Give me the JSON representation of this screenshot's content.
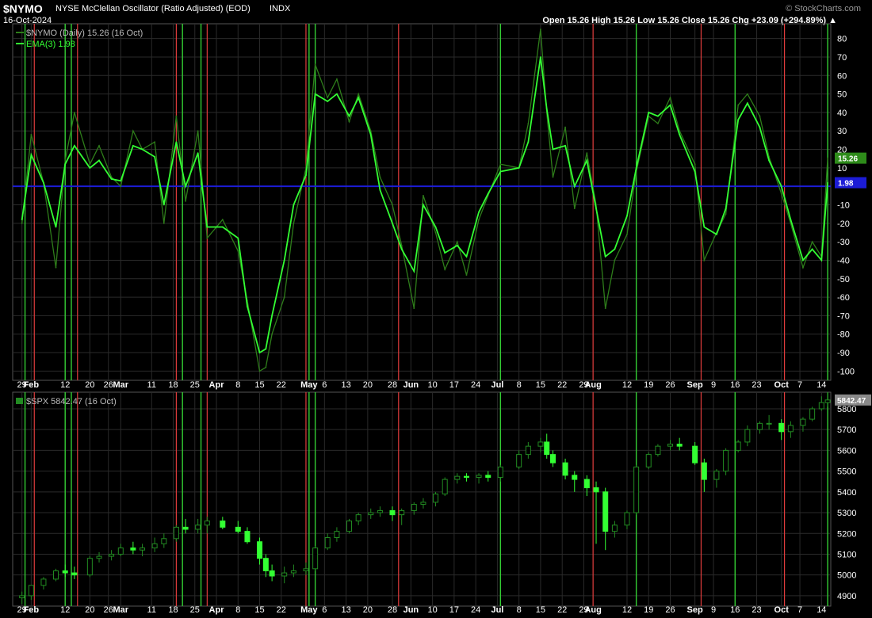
{
  "header": {
    "symbol": "$NYMO",
    "name": "NYSE McClellan Oscillator (Ratio Adjusted) (EOD)",
    "exchange": "INDX",
    "date": "16-Oct-2024",
    "watermark": "© StockCharts.com",
    "ohlc": "Open 15.26  High 15.26  Low 15.26  Close 15.26  Chg +23.09 (+294.89%) ▲"
  },
  "colors": {
    "background": "#000000",
    "osc_line": "#2e7d1a",
    "ema_line": "#33ff33",
    "zero_line": "#1c1cd6",
    "buy_signal": "#33cc33",
    "sell_signal": "#e03c3c",
    "candle_up": "#228b22",
    "candle_down": "#33ff33",
    "grid": "#2a2a2a"
  },
  "chart_data": [
    {
      "type": "line",
      "legend": [
        "$NYMO (Daily) 15.26 (16 Oct)",
        "EMA(3) 1.98"
      ],
      "ylim": [
        -105,
        88
      ],
      "yticks": [
        80,
        70,
        60,
        50,
        40,
        30,
        20,
        10,
        -10,
        -20,
        -30,
        -40,
        -50,
        -60,
        -70,
        -80,
        -90,
        -100
      ],
      "last_value_labels": [
        "15.26",
        "1.98"
      ],
      "zero_line": 0,
      "series": [
        {
          "name": "$NYMO (Daily)",
          "dates": [
            "2024-01-29",
            "2024-02-01",
            "2024-02-05",
            "2024-02-09",
            "2024-02-12",
            "2024-02-15",
            "2024-02-20",
            "2024-02-23",
            "2024-02-27",
            "2024-03-01",
            "2024-03-05",
            "2024-03-08",
            "2024-03-12",
            "2024-03-15",
            "2024-03-19",
            "2024-03-22",
            "2024-03-26",
            "2024-03-29",
            "2024-04-03",
            "2024-04-08",
            "2024-04-11",
            "2024-04-15",
            "2024-04-17",
            "2024-04-19",
            "2024-04-23",
            "2024-04-26",
            "2024-04-30",
            "2024-05-03",
            "2024-05-07",
            "2024-05-10",
            "2024-05-14",
            "2024-05-17",
            "2024-05-21",
            "2024-05-24",
            "2024-05-28",
            "2024-05-31",
            "2024-06-04",
            "2024-06-07",
            "2024-06-11",
            "2024-06-14",
            "2024-06-18",
            "2024-06-21",
            "2024-06-25",
            "2024-06-28",
            "2024-07-02",
            "2024-07-08",
            "2024-07-11",
            "2024-07-15",
            "2024-07-17",
            "2024-07-19",
            "2024-07-23",
            "2024-07-26",
            "2024-07-30",
            "2024-08-02",
            "2024-08-05",
            "2024-08-08",
            "2024-08-12",
            "2024-08-15",
            "2024-08-19",
            "2024-08-22",
            "2024-08-26",
            "2024-08-29",
            "2024-09-03",
            "2024-09-06",
            "2024-09-10",
            "2024-09-13",
            "2024-09-17",
            "2024-09-20",
            "2024-09-24",
            "2024-09-27",
            "2024-10-01",
            "2024-10-04",
            "2024-10-08",
            "2024-10-11",
            "2024-10-14",
            "2024-10-16"
          ],
          "values": [
            -20,
            28,
            2,
            -44,
            14,
            40,
            12,
            22,
            5,
            0,
            30,
            20,
            24,
            -20,
            38,
            -8,
            30,
            -28,
            -18,
            -35,
            -62,
            -100,
            -98,
            -80,
            -60,
            -20,
            10,
            66,
            48,
            58,
            35,
            50,
            30,
            5,
            -10,
            -32,
            -66,
            -5,
            -25,
            -45,
            -30,
            -48,
            -18,
            -5,
            12,
            10,
            34,
            85,
            40,
            5,
            32,
            -12,
            18,
            -10,
            -66,
            -40,
            -26,
            8,
            38,
            34,
            48,
            30,
            12,
            -40,
            -25,
            -15,
            44,
            50,
            38,
            16,
            -4,
            -20,
            -44,
            -30,
            -38,
            15.26
          ]
        },
        {
          "name": "EMA(3)",
          "dates": [
            "2024-01-29",
            "2024-02-01",
            "2024-02-05",
            "2024-02-09",
            "2024-02-12",
            "2024-02-15",
            "2024-02-20",
            "2024-02-23",
            "2024-02-27",
            "2024-03-01",
            "2024-03-05",
            "2024-03-08",
            "2024-03-12",
            "2024-03-15",
            "2024-03-19",
            "2024-03-22",
            "2024-03-26",
            "2024-03-29",
            "2024-04-03",
            "2024-04-08",
            "2024-04-11",
            "2024-04-15",
            "2024-04-17",
            "2024-04-19",
            "2024-04-23",
            "2024-04-26",
            "2024-04-30",
            "2024-05-03",
            "2024-05-07",
            "2024-05-10",
            "2024-05-14",
            "2024-05-17",
            "2024-05-21",
            "2024-05-24",
            "2024-05-28",
            "2024-05-31",
            "2024-06-04",
            "2024-06-07",
            "2024-06-11",
            "2024-06-14",
            "2024-06-18",
            "2024-06-21",
            "2024-06-25",
            "2024-06-28",
            "2024-07-02",
            "2024-07-08",
            "2024-07-11",
            "2024-07-15",
            "2024-07-17",
            "2024-07-19",
            "2024-07-23",
            "2024-07-26",
            "2024-07-30",
            "2024-08-02",
            "2024-08-05",
            "2024-08-08",
            "2024-08-12",
            "2024-08-15",
            "2024-08-19",
            "2024-08-22",
            "2024-08-26",
            "2024-08-29",
            "2024-09-03",
            "2024-09-06",
            "2024-09-10",
            "2024-09-13",
            "2024-09-17",
            "2024-09-20",
            "2024-09-24",
            "2024-09-27",
            "2024-10-01",
            "2024-10-04",
            "2024-10-08",
            "2024-10-11",
            "2024-10-14",
            "2024-10-16"
          ],
          "values": [
            -18,
            17,
            2,
            -22,
            12,
            22,
            10,
            14,
            4,
            3,
            22,
            20,
            16,
            -10,
            24,
            0,
            18,
            -22,
            -22,
            -28,
            -65,
            -90,
            -88,
            -70,
            -40,
            -10,
            6,
            50,
            46,
            50,
            38,
            48,
            28,
            -2,
            -20,
            -34,
            -46,
            -10,
            -22,
            -36,
            -32,
            -38,
            -14,
            -4,
            8,
            10,
            24,
            70,
            42,
            20,
            22,
            0,
            14,
            -12,
            -38,
            -34,
            -16,
            10,
            40,
            38,
            44,
            28,
            8,
            -22,
            -26,
            -12,
            36,
            45,
            32,
            14,
            0,
            -18,
            -40,
            -34,
            -40,
            1.98
          ]
        }
      ]
    },
    {
      "type": "candlestick",
      "legend": [
        "$SPX 5842.47 (16 Oct)"
      ],
      "ylim": [
        4850,
        5880
      ],
      "yticks": [
        5800,
        5700,
        5600,
        5500,
        5400,
        5300,
        5200,
        5100,
        5000,
        4900
      ],
      "last_value_labels": [
        "5842.47"
      ],
      "dates": [
        "2024-01-29",
        "2024-02-01",
        "2024-02-05",
        "2024-02-09",
        "2024-02-12",
        "2024-02-15",
        "2024-02-20",
        "2024-02-23",
        "2024-02-27",
        "2024-03-01",
        "2024-03-05",
        "2024-03-08",
        "2024-03-12",
        "2024-03-15",
        "2024-03-19",
        "2024-03-22",
        "2024-03-26",
        "2024-03-29",
        "2024-04-03",
        "2024-04-08",
        "2024-04-11",
        "2024-04-15",
        "2024-04-17",
        "2024-04-19",
        "2024-04-23",
        "2024-04-26",
        "2024-04-30",
        "2024-05-03",
        "2024-05-07",
        "2024-05-10",
        "2024-05-14",
        "2024-05-17",
        "2024-05-21",
        "2024-05-24",
        "2024-05-28",
        "2024-05-31",
        "2024-06-04",
        "2024-06-07",
        "2024-06-11",
        "2024-06-14",
        "2024-06-18",
        "2024-06-21",
        "2024-06-25",
        "2024-06-28",
        "2024-07-02",
        "2024-07-08",
        "2024-07-11",
        "2024-07-15",
        "2024-07-17",
        "2024-07-19",
        "2024-07-23",
        "2024-07-26",
        "2024-07-30",
        "2024-08-02",
        "2024-08-05",
        "2024-08-08",
        "2024-08-12",
        "2024-08-15",
        "2024-08-19",
        "2024-08-22",
        "2024-08-26",
        "2024-08-29",
        "2024-09-03",
        "2024-09-06",
        "2024-09-10",
        "2024-09-13",
        "2024-09-17",
        "2024-09-20",
        "2024-09-24",
        "2024-09-27",
        "2024-10-01",
        "2024-10-04",
        "2024-10-08",
        "2024-10-11",
        "2024-10-14",
        "2024-10-16"
      ],
      "open": [
        4890,
        4900,
        4950,
        4980,
        5020,
        5010,
        5000,
        5080,
        5090,
        5100,
        5130,
        5120,
        5130,
        5150,
        5175,
        5230,
        5220,
        5240,
        5260,
        5230,
        5210,
        5160,
        5080,
        5020,
        4995,
        5010,
        5020,
        5030,
        5130,
        5180,
        5210,
        5260,
        5290,
        5300,
        5310,
        5290,
        5310,
        5340,
        5350,
        5390,
        5460,
        5475,
        5470,
        5480,
        5470,
        5520,
        5580,
        5620,
        5640,
        5580,
        5540,
        5480,
        5460,
        5420,
        5400,
        5210,
        5240,
        5300,
        5520,
        5580,
        5620,
        5630,
        5620,
        5540,
        5460,
        5500,
        5600,
        5640,
        5700,
        5730,
        5730,
        5690,
        5720,
        5750,
        5800,
        5830
      ],
      "high": [
        4920,
        4950,
        4990,
        5030,
        5050,
        5040,
        5090,
        5110,
        5120,
        5150,
        5160,
        5150,
        5180,
        5200,
        5240,
        5270,
        5270,
        5280,
        5280,
        5260,
        5230,
        5180,
        5100,
        5050,
        5040,
        5050,
        5060,
        5140,
        5200,
        5230,
        5270,
        5300,
        5320,
        5330,
        5330,
        5320,
        5350,
        5370,
        5400,
        5470,
        5490,
        5490,
        5490,
        5500,
        5530,
        5600,
        5640,
        5660,
        5680,
        5600,
        5560,
        5500,
        5480,
        5450,
        5420,
        5260,
        5310,
        5530,
        5590,
        5630,
        5650,
        5660,
        5640,
        5560,
        5510,
        5610,
        5650,
        5720,
        5740,
        5770,
        5750,
        5740,
        5760,
        5810,
        5860,
        5880
      ],
      "low": [
        4860,
        4880,
        4930,
        4970,
        4990,
        4980,
        4990,
        5060,
        5070,
        5090,
        5100,
        5090,
        5110,
        5130,
        5160,
        5200,
        5200,
        5200,
        5220,
        5200,
        5150,
        5050,
        4990,
        4970,
        4960,
        4990,
        5000,
        5020,
        5120,
        5160,
        5200,
        5240,
        5270,
        5280,
        5260,
        5240,
        5290,
        5320,
        5330,
        5380,
        5440,
        5450,
        5440,
        5450,
        5450,
        5510,
        5560,
        5590,
        5560,
        5520,
        5460,
        5400,
        5380,
        5150,
        5120,
        5180,
        5220,
        5290,
        5510,
        5570,
        5600,
        5600,
        5530,
        5400,
        5420,
        5480,
        5590,
        5620,
        5680,
        5700,
        5650,
        5660,
        5690,
        5740,
        5790,
        5810
      ],
      "close": [
        4900,
        4950,
        4980,
        5020,
        5010,
        5000,
        5080,
        5090,
        5100,
        5130,
        5120,
        5130,
        5150,
        5175,
        5230,
        5220,
        5240,
        5260,
        5230,
        5210,
        5160,
        5080,
        5020,
        4995,
        5010,
        5020,
        5030,
        5130,
        5180,
        5210,
        5260,
        5290,
        5300,
        5310,
        5290,
        5310,
        5340,
        5350,
        5390,
        5460,
        5475,
        5470,
        5480,
        5470,
        5520,
        5580,
        5620,
        5640,
        5580,
        5540,
        5480,
        5460,
        5420,
        5400,
        5210,
        5240,
        5300,
        5520,
        5580,
        5620,
        5630,
        5620,
        5540,
        5460,
        5500,
        5600,
        5640,
        5700,
        5730,
        5730,
        5690,
        5720,
        5750,
        5800,
        5830,
        5842.47
      ]
    }
  ],
  "x_axis": {
    "labels": [
      {
        "text": "29",
        "date": "2024-01-29",
        "bold": false
      },
      {
        "text": "Feb",
        "date": "2024-02-01",
        "bold": true
      },
      {
        "text": "12",
        "date": "2024-02-12",
        "bold": false
      },
      {
        "text": "20",
        "date": "2024-02-20",
        "bold": false
      },
      {
        "text": "26",
        "date": "2024-02-26",
        "bold": false
      },
      {
        "text": "Mar",
        "date": "2024-03-01",
        "bold": true
      },
      {
        "text": "11",
        "date": "2024-03-11",
        "bold": false
      },
      {
        "text": "18",
        "date": "2024-03-18",
        "bold": false
      },
      {
        "text": "25",
        "date": "2024-03-25",
        "bold": false
      },
      {
        "text": "Apr",
        "date": "2024-04-01",
        "bold": true
      },
      {
        "text": "8",
        "date": "2024-04-08",
        "bold": false
      },
      {
        "text": "15",
        "date": "2024-04-15",
        "bold": false
      },
      {
        "text": "22",
        "date": "2024-04-22",
        "bold": false
      },
      {
        "text": "May",
        "date": "2024-05-01",
        "bold": true
      },
      {
        "text": "6",
        "date": "2024-05-06",
        "bold": false
      },
      {
        "text": "13",
        "date": "2024-05-13",
        "bold": false
      },
      {
        "text": "20",
        "date": "2024-05-20",
        "bold": false
      },
      {
        "text": "28",
        "date": "2024-05-28",
        "bold": false
      },
      {
        "text": "Jun",
        "date": "2024-06-03",
        "bold": true
      },
      {
        "text": "10",
        "date": "2024-06-10",
        "bold": false
      },
      {
        "text": "17",
        "date": "2024-06-17",
        "bold": false
      },
      {
        "text": "24",
        "date": "2024-06-24",
        "bold": false
      },
      {
        "text": "Jul",
        "date": "2024-07-01",
        "bold": true
      },
      {
        "text": "8",
        "date": "2024-07-08",
        "bold": false
      },
      {
        "text": "15",
        "date": "2024-07-15",
        "bold": false
      },
      {
        "text": "22",
        "date": "2024-07-22",
        "bold": false
      },
      {
        "text": "29",
        "date": "2024-07-29",
        "bold": false
      },
      {
        "text": "Aug",
        "date": "2024-08-01",
        "bold": true
      },
      {
        "text": "12",
        "date": "2024-08-12",
        "bold": false
      },
      {
        "text": "19",
        "date": "2024-08-19",
        "bold": false
      },
      {
        "text": "26",
        "date": "2024-08-26",
        "bold": false
      },
      {
        "text": "Sep",
        "date": "2024-09-03",
        "bold": true
      },
      {
        "text": "9",
        "date": "2024-09-09",
        "bold": false
      },
      {
        "text": "16",
        "date": "2024-09-16",
        "bold": false
      },
      {
        "text": "23",
        "date": "2024-09-23",
        "bold": false
      },
      {
        "text": "Oct",
        "date": "2024-10-01",
        "bold": true
      },
      {
        "text": "7",
        "date": "2024-10-07",
        "bold": false
      },
      {
        "text": "14",
        "date": "2024-10-14",
        "bold": false
      }
    ]
  },
  "signals": {
    "buy": [
      "2024-01-30",
      "2024-02-12",
      "2024-02-14",
      "2024-03-21",
      "2024-03-27",
      "2024-05-01",
      "2024-05-03",
      "2024-07-02",
      "2024-08-15",
      "2024-09-16",
      "2024-10-16"
    ],
    "sell": [
      "2024-02-02",
      "2024-02-16",
      "2024-03-19",
      "2024-03-29",
      "2024-04-30",
      "2024-05-30",
      "2024-08-01",
      "2024-09-05",
      "2024-10-02"
    ]
  }
}
